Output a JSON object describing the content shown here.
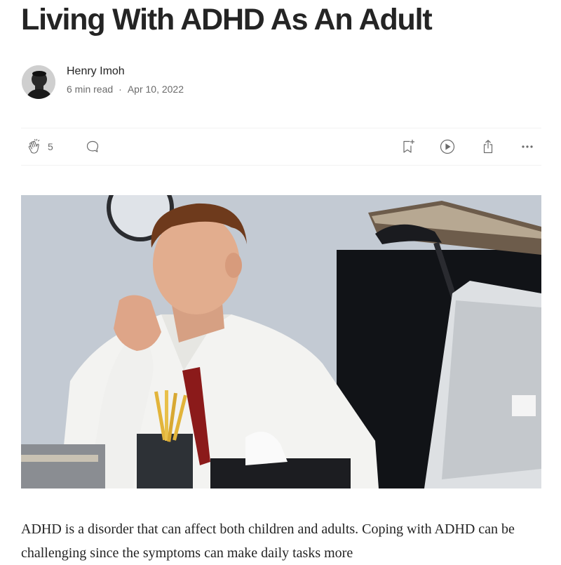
{
  "article": {
    "title": "Living With ADHD As An Adult",
    "author": "Henry Imoh",
    "read_time": "6 min read",
    "separator": "·",
    "date": "Apr 10, 2022"
  },
  "actions": {
    "clap_count": "5"
  },
  "icons": {
    "clap": "clap-icon",
    "comment": "comment-icon",
    "save": "bookmark-add-icon",
    "listen": "play-circle-icon",
    "share": "share-icon",
    "more": "more-horizontal-icon"
  },
  "body": {
    "paragraph1": "ADHD is a disorder that can affect both children and adults. Coping with ADHD can be challenging since the symptoms can make daily tasks more"
  },
  "colors": {
    "text": "#242424",
    "muted": "#6b6b6b",
    "divider": "#f2f2f2"
  }
}
